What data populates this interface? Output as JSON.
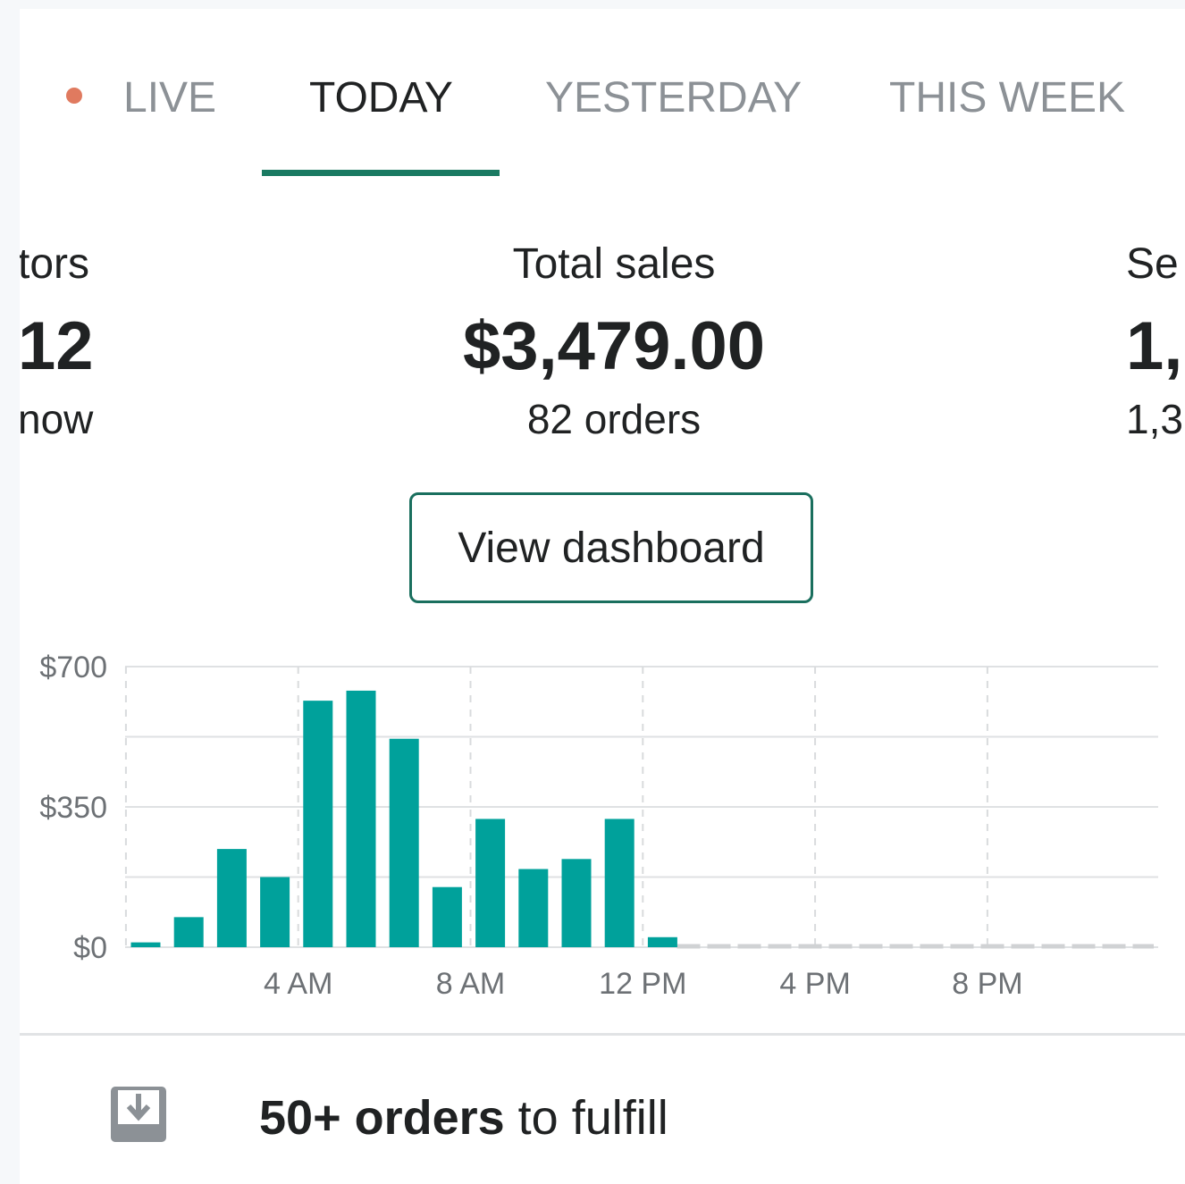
{
  "tabs": [
    {
      "label": "LIVE",
      "active": false
    },
    {
      "label": "TODAY",
      "active": true
    },
    {
      "label": "YESTERDAY",
      "active": false
    },
    {
      "label": "THIS WEEK",
      "active": false
    }
  ],
  "colors": {
    "accent": "#008060",
    "bar": "#00a19b",
    "live_dot": "#e07a5f",
    "underline": "#1a7a62"
  },
  "metrics": {
    "left": {
      "label": "tors",
      "value": "12",
      "sub": "now"
    },
    "center": {
      "label": "Total sales",
      "value": "$3,479.00",
      "sub": "82 orders"
    },
    "right": {
      "label": "Se",
      "value": "1,",
      "sub": "1,3"
    }
  },
  "view_dashboard_label": "View dashboard",
  "chart_data": {
    "type": "bar",
    "x": [
      0,
      1,
      2,
      3,
      4,
      5,
      6,
      7,
      8,
      9,
      10,
      11,
      12,
      13,
      14,
      15,
      16,
      17,
      18,
      19,
      20,
      21,
      22,
      23
    ],
    "values": [
      12,
      75,
      245,
      175,
      615,
      640,
      520,
      150,
      320,
      195,
      220,
      320,
      25,
      0,
      0,
      0,
      0,
      0,
      0,
      0,
      0,
      0,
      0,
      0
    ],
    "xtick_labels": [
      "4 AM",
      "8 AM",
      "12 PM",
      "4 PM",
      "8 PM"
    ],
    "xtick_hours": [
      4,
      8,
      12,
      16,
      20
    ],
    "ytick_labels": [
      "$700",
      "$350",
      "$0"
    ],
    "ytick_values": [
      700,
      350,
      0
    ],
    "ylim": [
      0,
      700
    ]
  },
  "fulfill": {
    "count": "50+ orders",
    "suffix": " to fulfill",
    "icon": "inbox-download-icon"
  }
}
